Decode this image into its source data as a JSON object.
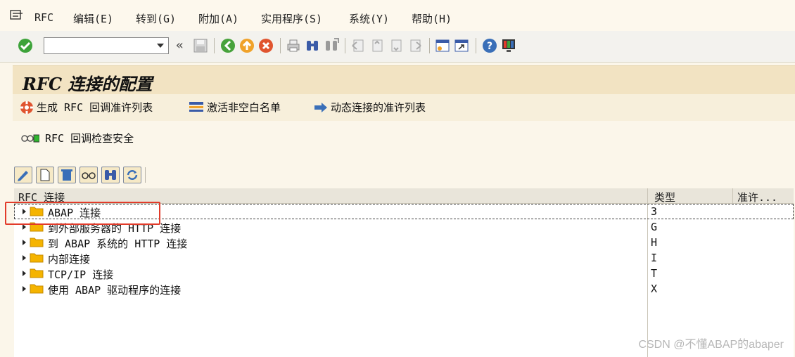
{
  "menubar": {
    "items": [
      "RFC",
      "编辑(E)",
      "转到(G)",
      "附加(A)",
      "实用程序(S)",
      "系统(Y)",
      "帮助(H)"
    ]
  },
  "toolbar": {
    "command_value": "",
    "collapse_label": "«"
  },
  "title": "RFC 连接的配置",
  "appbar": {
    "generate": "生成 RFC 回调准许列表",
    "activate": "激活非空白名单",
    "dynamic": "动态连接的准许列表"
  },
  "security": {
    "label": "RFC 回调检查安全"
  },
  "grid": {
    "columns": [
      "RFC 连接",
      "类型",
      "准许..."
    ],
    "rows": [
      {
        "label": "ABAP 连接",
        "type": "3"
      },
      {
        "label": "到外部服务器的 HTTP 连接",
        "type": "G"
      },
      {
        "label": "到 ABAP 系统的 HTTP 连接",
        "type": "H"
      },
      {
        "label": "内部连接",
        "type": "I"
      },
      {
        "label": "TCP/IP 连接",
        "type": "T"
      },
      {
        "label": "使用 ABAP 驱动程序的连接",
        "type": "X"
      }
    ]
  },
  "watermark": "CSDN @不懂ABAP的abaper",
  "colors": {
    "title_bg": "#f2e3c2",
    "highlight": "#e23b2a",
    "folder": "#f5b400"
  }
}
